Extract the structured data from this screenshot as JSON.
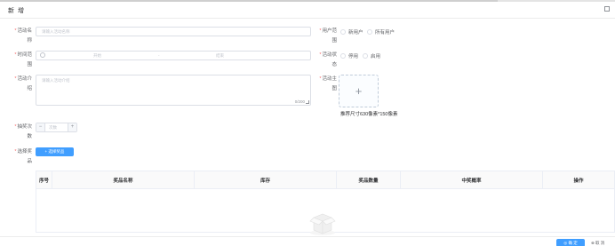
{
  "dialog": {
    "title": "新 增"
  },
  "form": {
    "activity_name": {
      "label": "活动名称",
      "placeholder": "请输入活动名称"
    },
    "user_scope": {
      "label": "用户范围",
      "options": [
        "新用户",
        "所有用户"
      ]
    },
    "time_range": {
      "label": "时间范围",
      "start_placeholder": "开始",
      "separator": "-",
      "end_placeholder": "结束"
    },
    "activity_status": {
      "label": "活动状态",
      "options": [
        "停用",
        "启用"
      ]
    },
    "activity_intro": {
      "label": "活动介绍",
      "placeholder": "请输入活动介绍",
      "counter": "0/200"
    },
    "activity_banner": {
      "label": "活动主图",
      "upload_icon": "plus-icon",
      "tip": "推荐尺寸630像素*150像素"
    },
    "draw_times": {
      "label": "抽奖次数",
      "minus": "−",
      "plus": "+",
      "placeholder": "次数"
    },
    "select_prize": {
      "label": "选择奖品",
      "button": "+ 选择奖品"
    }
  },
  "table": {
    "headers": [
      "序号",
      "奖品名称",
      "库存",
      "奖品数量",
      "中奖概率",
      "操作"
    ]
  },
  "footer": {
    "confirm": "确 定",
    "cancel": "取 消"
  },
  "colors": {
    "primary": "#409eff",
    "required": "#f56c6c",
    "border": "#dcdfe6"
  }
}
